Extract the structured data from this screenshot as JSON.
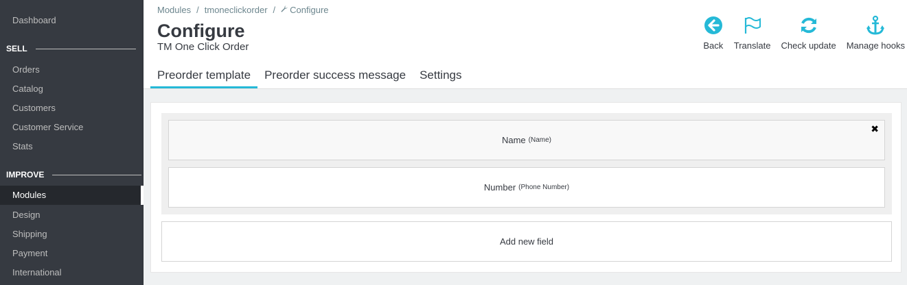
{
  "sidebar": {
    "dashboard": "Dashboard",
    "sell_section": "SELL",
    "sell_items": [
      "Orders",
      "Catalog",
      "Customers",
      "Customer Service",
      "Stats"
    ],
    "improve_section": "IMPROVE",
    "improve_items": [
      "Modules",
      "Design",
      "Shipping",
      "Payment",
      "International"
    ],
    "active_item": "Modules"
  },
  "breadcrumb": {
    "items": [
      "Modules",
      "tmoneclickorder",
      "Configure"
    ]
  },
  "header": {
    "title": "Configure",
    "subtitle": "TM One Click Order"
  },
  "toolbar": {
    "back": "Back",
    "translate": "Translate",
    "check_update": "Check update",
    "manage_hooks": "Manage hooks"
  },
  "tabs": [
    "Preorder template",
    "Preorder success message",
    "Settings"
  ],
  "fields": [
    {
      "label": "Name",
      "hint": "(Name)"
    },
    {
      "label": "Number",
      "hint": "(Phone Number)"
    }
  ],
  "add_field_label": "Add new field",
  "close_glyph": "✖",
  "colors": {
    "accent": "#25b9d7",
    "sidebar_bg": "#363a41",
    "sidebar_active_bg": "#25282d"
  },
  "icons": {
    "back": "arrow-circle-left-icon",
    "translate": "flag-icon",
    "check_update": "refresh-icon",
    "manage_hooks": "anchor-icon",
    "breadcrumb": "wrench-icon",
    "remove": "close-icon"
  }
}
